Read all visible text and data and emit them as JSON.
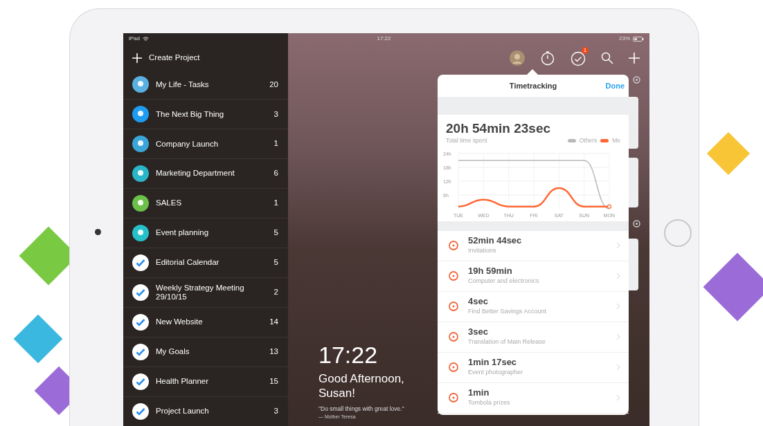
{
  "status_bar": {
    "device": "iPad",
    "time": "17:22",
    "battery": "23%"
  },
  "sidebar": {
    "create_label": "Create Project",
    "items": [
      {
        "kind": "image",
        "color": "#5ab0e0",
        "label": "My Life - Tasks",
        "count": "20"
      },
      {
        "kind": "image",
        "color": "#1e9cf0",
        "label": "The Next Big Thing",
        "count": "3"
      },
      {
        "kind": "image",
        "color": "#3aa6d8",
        "label": "Company Launch",
        "count": "1"
      },
      {
        "kind": "image",
        "color": "#2bb5c8",
        "label": "Marketing Department",
        "count": "6"
      },
      {
        "kind": "image",
        "color": "#6cc04a",
        "label": "SALES",
        "count": "1"
      },
      {
        "kind": "image",
        "color": "#28c0c8",
        "label": "Event planning",
        "count": "5"
      },
      {
        "kind": "check",
        "label": "Editorial Calendar",
        "count": "5"
      },
      {
        "kind": "check",
        "label": "Weekly Strategy Meeting 29/10/15",
        "count": "2"
      },
      {
        "kind": "check",
        "label": "New Website",
        "count": "14"
      },
      {
        "kind": "check",
        "label": "My Goals",
        "count": "13"
      },
      {
        "kind": "check",
        "label": "Health Planner",
        "count": "15"
      },
      {
        "kind": "check",
        "label": "Project Launch",
        "count": "3"
      }
    ]
  },
  "toolbar": {
    "badge": "1"
  },
  "home": {
    "time": "17:22",
    "greeting": "Good Afternoon, Susan!",
    "quote": "\"Do small things with great love.\"",
    "author": "— Mother Teresa"
  },
  "timetracking": {
    "title": "Timetracking",
    "done": "Done",
    "total": "20h 54min 23sec",
    "total_label": "Total time spent",
    "chart_data": {
      "type": "line",
      "grid": true,
      "categories": [
        "TUE",
        "WED",
        "THU",
        "FRI",
        "SAT",
        "SUN",
        "MON"
      ],
      "ylim": [
        0,
        24
      ],
      "yticks": [
        {
          "value": 6,
          "label": "6h"
        },
        {
          "value": 12,
          "label": "12h"
        },
        {
          "value": 18,
          "label": "18h"
        },
        {
          "value": 24,
          "label": "24h"
        }
      ],
      "series": [
        {
          "name": "Others",
          "color": "#b8b8b8",
          "values": [
            21,
            21,
            21,
            21,
            21,
            21,
            0
          ]
        },
        {
          "name": "Me",
          "color": "#ff6633",
          "values": [
            1,
            4,
            1,
            1,
            9,
            1,
            1
          ]
        }
      ]
    },
    "entries": [
      {
        "time": "52min 44sec",
        "task": "Invitations"
      },
      {
        "time": "19h 59min",
        "task": "Computer and electronics"
      },
      {
        "time": "4sec",
        "task": "Find Better Savings Account"
      },
      {
        "time": "3sec",
        "task": "Translation of Main Release"
      },
      {
        "time": "1min 17sec",
        "task": "Event photographer"
      },
      {
        "time": "1min",
        "task": "Tombola prizes"
      }
    ]
  }
}
